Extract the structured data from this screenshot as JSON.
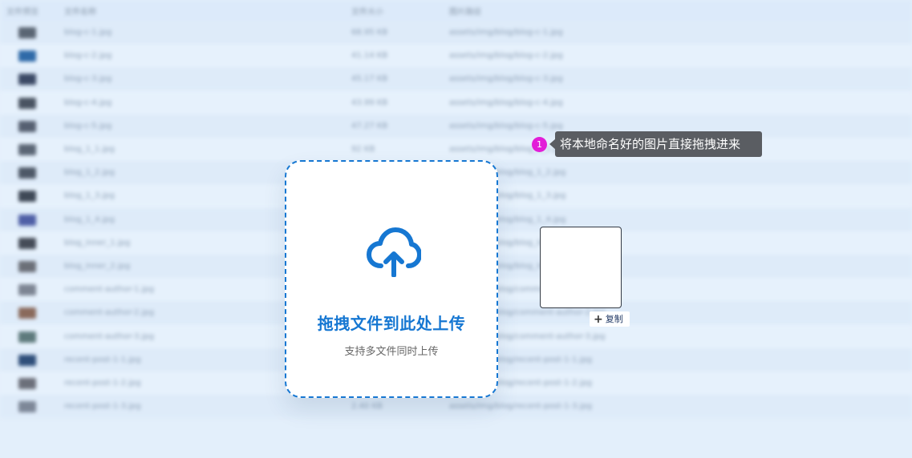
{
  "background_table": {
    "headers": [
      "文件预览",
      "文件名称",
      "文件大小",
      "图片路径"
    ],
    "rows": [
      {
        "name": "blog-c-1.jpg",
        "size": "68.95 KB",
        "path": "assets/img/blog/blog-c-1.jpg",
        "thumb_color": "#5a6573"
      },
      {
        "name": "blog-c-2.jpg",
        "size": "41.14 KB",
        "path": "assets/img/blog/blog-c-2.jpg",
        "thumb_color": "#2f6aa8"
      },
      {
        "name": "blog-c-3.jpg",
        "size": "45.17 KB",
        "path": "assets/img/blog/blog-c-3.jpg",
        "thumb_color": "#3c4a66"
      },
      {
        "name": "blog-c-4.jpg",
        "size": "43.99 KB",
        "path": "assets/img/blog/blog-c-4.jpg",
        "thumb_color": "#4a5462"
      },
      {
        "name": "blog-c-5.jpg",
        "size": "47.27 KB",
        "path": "assets/img/blog/blog-c-5.jpg",
        "thumb_color": "#566071"
      },
      {
        "name": "blog_1_1.jpg",
        "size": "92 KB",
        "path": "assets/img/blog/blog_1_1.jpg",
        "thumb_color": "#5b6675"
      },
      {
        "name": "blog_1_2.jpg",
        "size": "",
        "path": "assets/img/blog/blog_1_2.jpg",
        "thumb_color": "#4d5867"
      },
      {
        "name": "blog_1_3.jpg",
        "size": "",
        "path": "assets/img/blog/blog_1_3.jpg",
        "thumb_color": "#3f4957"
      },
      {
        "name": "blog_1_4.jpg",
        "size": "",
        "path": "assets/img/blog/blog_1_4.jpg",
        "thumb_color": "#4f5fa6"
      },
      {
        "name": "blog_inner_1.jpg",
        "size": "",
        "path": "assets/img/blog/blog_inner_1.jpg",
        "thumb_color": "#454c58"
      },
      {
        "name": "blog_inner_2.jpg",
        "size": "",
        "path": "assets/img/blog/blog_inner_2.jpg",
        "thumb_color": "#6b6f78"
      },
      {
        "name": "comment-author-1.jpg",
        "size": "",
        "path": "assets/img/blog/comment-author-1.jpg",
        "thumb_color": "#7d8593"
      },
      {
        "name": "comment-author-2.jpg",
        "size": "",
        "path": "assets/img/blog/comment-author-2.jpg",
        "thumb_color": "#8a6a5c"
      },
      {
        "name": "comment-author-3.jpg",
        "size": "",
        "path": "assets/img/blog/comment-author-3.jpg",
        "thumb_color": "#5e7a7c"
      },
      {
        "name": "recent-post-1-1.jpg",
        "size": "",
        "path": "assets/img/blog/recent-post-1-1.jpg",
        "thumb_color": "#2f4f7a"
      },
      {
        "name": "recent-post-1-2.jpg",
        "size": "",
        "path": "assets/img/blog/recent-post-1-2.jpg",
        "thumb_color": "#6c6f7a"
      },
      {
        "name": "recent-post-1-3.jpg",
        "size": "2.40 KB",
        "path": "assets/img/blog/recent-post-1-3.jpg",
        "thumb_color": "#7d8798"
      }
    ]
  },
  "dropzone": {
    "title": "拖拽文件到此处上传",
    "subtitle": "支持多文件同时上传"
  },
  "tooltip": {
    "step": "1",
    "text": "将本地命名好的图片直接拖拽进来"
  },
  "preview": {
    "copy_label": "复制"
  },
  "colors": {
    "accent": "#1677d2",
    "badge": "#e21ed8",
    "tooltip_bg": "#5a5d62"
  }
}
